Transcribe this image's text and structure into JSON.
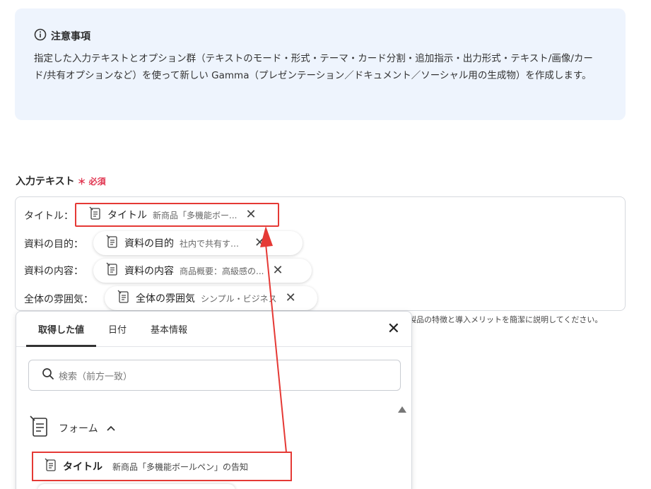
{
  "notice": {
    "title": "注意事項",
    "body": "指定した入力テキストとオプション群（テキストのモード・形式・テーマ・カード分割・追加指示・出力形式・テキスト/画像/カード/共有オプションなど）を使って新しい Gamma（プレゼンテーション／ドキュメント／ソーシャル用の生成物）を作成します。"
  },
  "input_field": {
    "label": "入力テキスト",
    "required_mark": "＊",
    "required_text": "必須",
    "rows": [
      {
        "label": "タイトル：",
        "chip_title": "タイトル",
        "chip_value": "新商品「多機能ボー..."
      },
      {
        "label": "資料の目的：",
        "chip_title": "資料の目的",
        "chip_value": "社内で共有するため"
      },
      {
        "label": "資料の内容：",
        "chip_title": "資料の内容",
        "chip_value": "商品概要：高級感の..."
      },
      {
        "label": "全体の雰囲気：",
        "chip_title": "全体の雰囲気",
        "chip_value": "シンプル・ビジネス"
      }
    ],
    "hint_text": "製品の特徴と導入メリットを簡潔に説明してください。"
  },
  "picker": {
    "tabs": [
      "取得した値",
      "日付",
      "基本情報"
    ],
    "active_tab": "取得した値",
    "search_placeholder": "検索（前方一致）",
    "group_label": "フォーム",
    "item": {
      "title": "タイトル",
      "value": "新商品「多機能ボールペン」の告知"
    }
  },
  "colors": {
    "notice_bg": "#eef4fd",
    "required": "#e0344f",
    "highlight": "#e53935"
  },
  "icons": {
    "info": "info-circle-icon",
    "form": "form-document-icon",
    "close": "close-icon",
    "search": "search-icon",
    "chevron": "chevron-up-icon"
  }
}
